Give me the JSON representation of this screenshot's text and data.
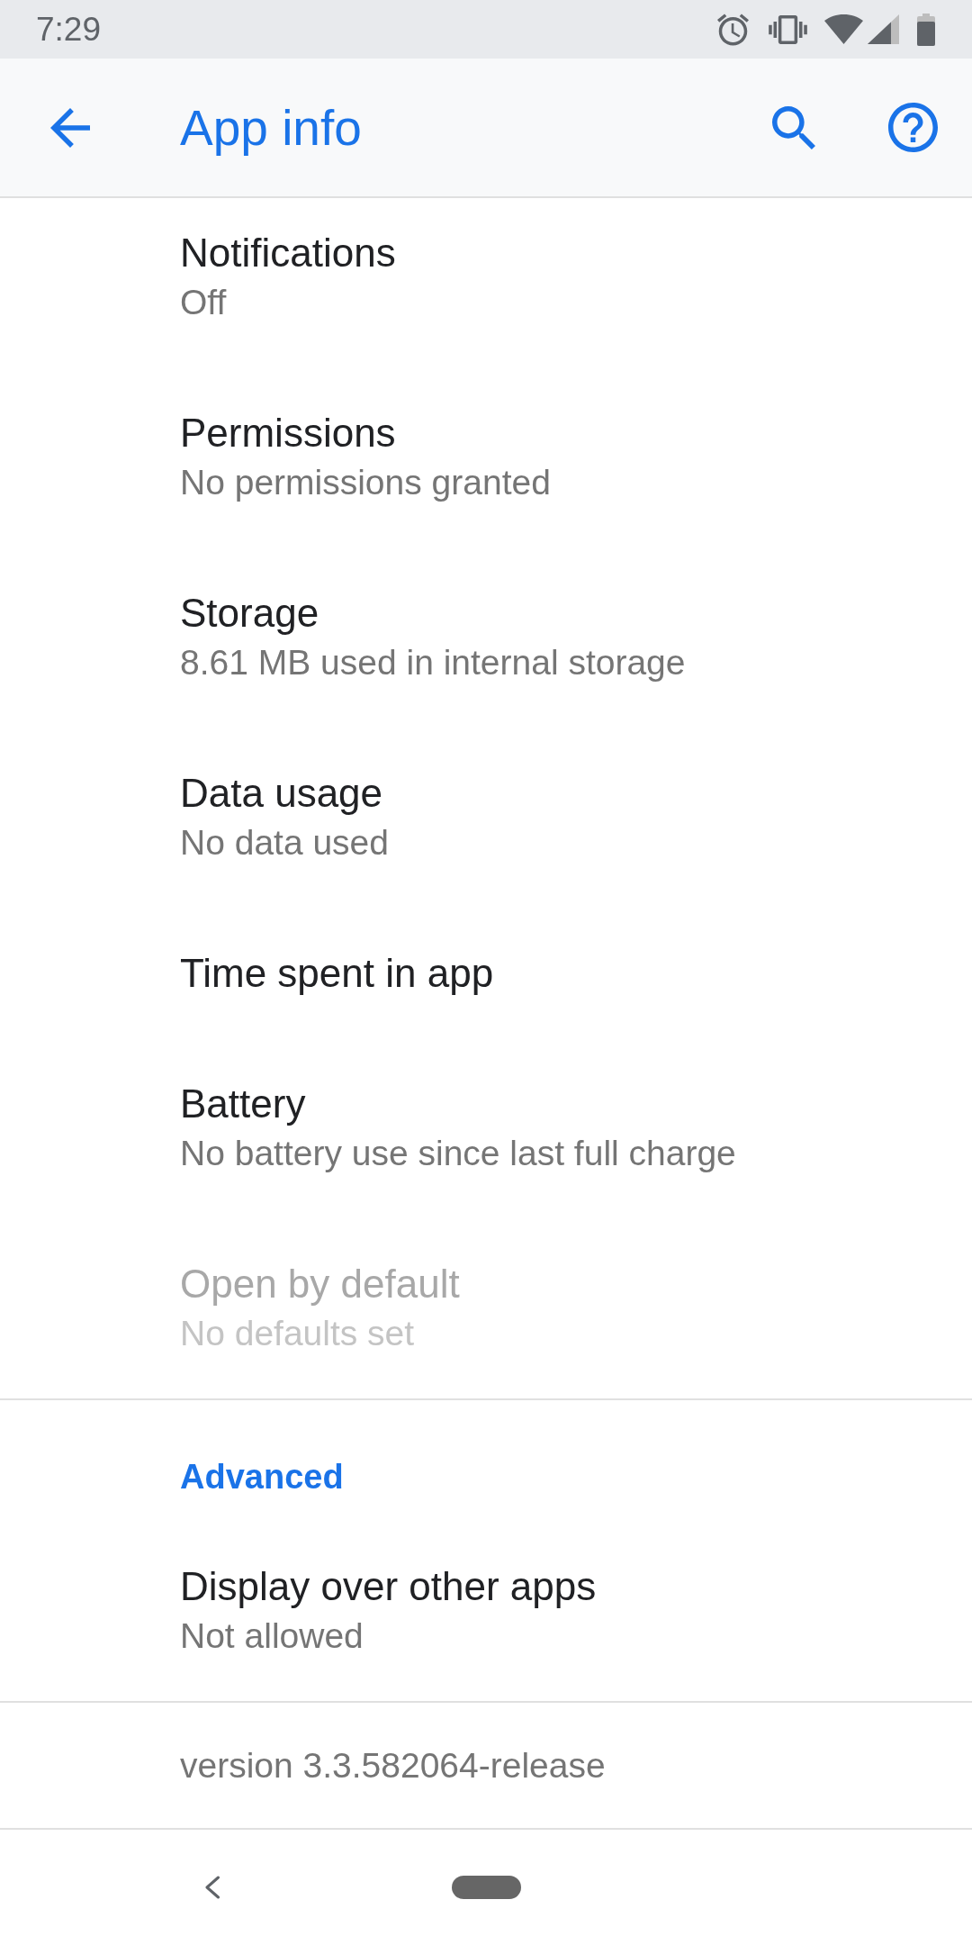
{
  "status_bar": {
    "time": "7:29"
  },
  "app_bar": {
    "title": "App info"
  },
  "items": [
    {
      "title": "Notifications",
      "subtitle": "Off",
      "disabled": false
    },
    {
      "title": "Permissions",
      "subtitle": "No permissions granted",
      "disabled": false
    },
    {
      "title": "Storage",
      "subtitle": "8.61 MB used in internal storage",
      "disabled": false
    },
    {
      "title": "Data usage",
      "subtitle": "No data used",
      "disabled": false
    },
    {
      "title": "Time spent in app",
      "disabled": false
    },
    {
      "title": "Battery",
      "subtitle": "No battery use since last full charge",
      "disabled": false
    },
    {
      "title": "Open by default",
      "subtitle": "No defaults set",
      "disabled": true
    }
  ],
  "advanced": {
    "header": "Advanced",
    "items": [
      {
        "title": "Display over other apps",
        "subtitle": "Not allowed",
        "disabled": false
      }
    ]
  },
  "version": "version 3.3.582064-release"
}
